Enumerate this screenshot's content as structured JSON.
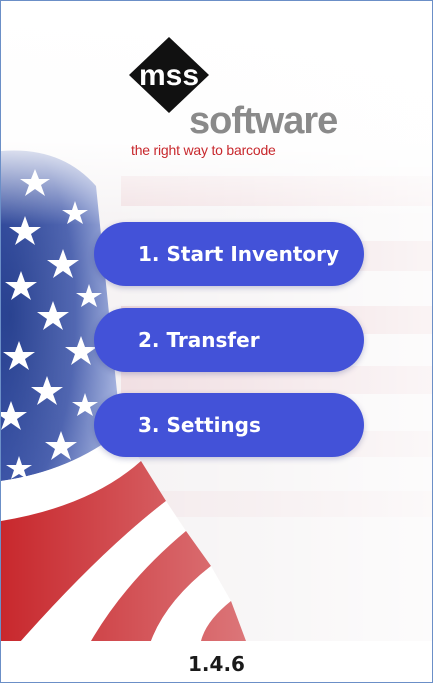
{
  "app": {
    "logo_text_top": "mss",
    "logo_text_main": "software",
    "tagline": "the right way to barcode"
  },
  "menu": {
    "items": [
      {
        "label": "1. Start Inventory"
      },
      {
        "label": "2. Transfer"
      },
      {
        "label": "3. Settings"
      }
    ]
  },
  "footer": {
    "version": "1.4.6"
  },
  "colors": {
    "button_bg": "#4352d8",
    "button_text": "#ffffff",
    "tagline": "#c8282d",
    "flag_red": "#c8282d",
    "flag_blue": "#2b3a8c"
  }
}
